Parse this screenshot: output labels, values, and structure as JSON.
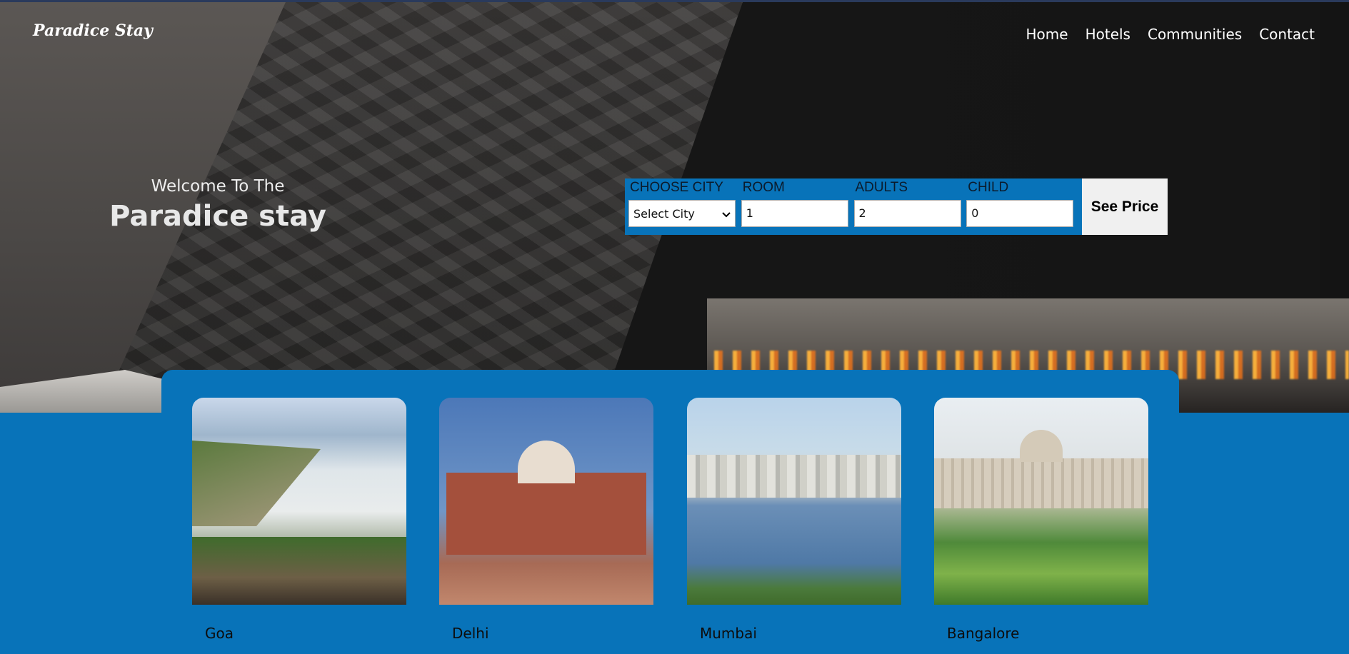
{
  "brand": "Paradice Stay",
  "nav": [
    "Home",
    "Hotels",
    "Communities",
    "Contact"
  ],
  "welcome": {
    "line1": "Welcome To The",
    "line2": "Paradice stay"
  },
  "search": {
    "city_label": "CHOOSE CITY",
    "city_value": "Select City",
    "room_label": "ROOM",
    "room_value": "1",
    "adults_label": "ADULTS",
    "adults_value": "2",
    "child_label": "CHILD",
    "child_value": "0",
    "button": "See Price"
  },
  "cities": [
    "Goa",
    "Delhi",
    "Mumbai",
    "Bangalore"
  ],
  "colors": {
    "accent": "#0873b9",
    "button_bg": "#f0f0f0"
  }
}
